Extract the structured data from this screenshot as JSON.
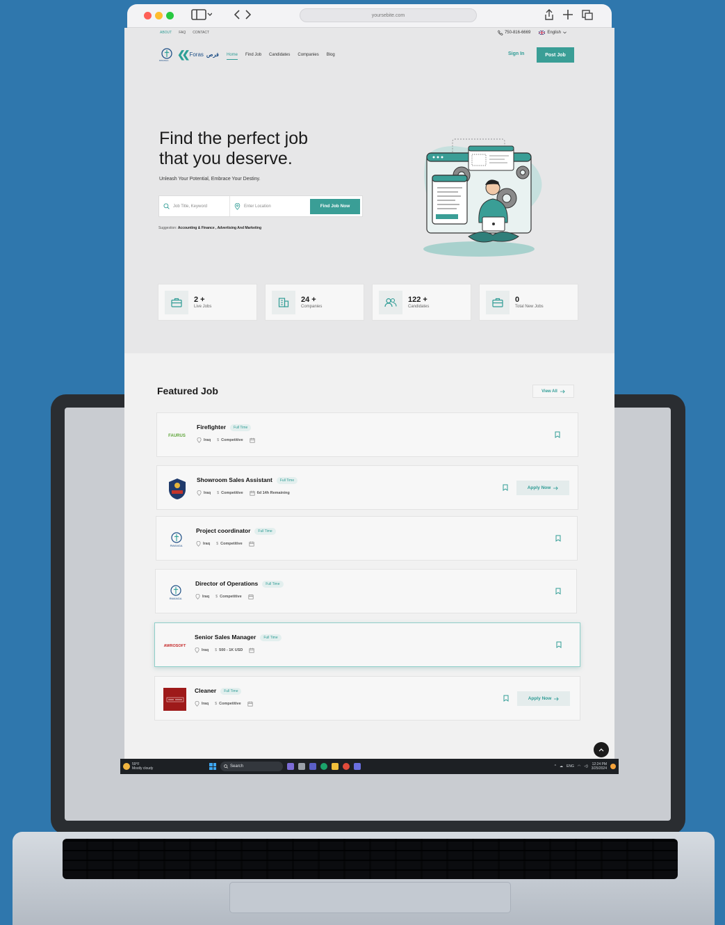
{
  "browser": {
    "url": "yoursebite.com",
    "colors": {
      "close": "#fe5f57",
      "minimize": "#febc2e",
      "maximize": "#28c840"
    }
  },
  "topbar": {
    "links": [
      "ABOUT",
      "FAQ",
      "CONTACT"
    ],
    "phone": "750-816-6669",
    "language": "English"
  },
  "header": {
    "logo_partner": "RWANGA",
    "logo_brand": "Foras",
    "logo_brand_ar": "فرص",
    "nav": [
      "Home",
      "Find Job",
      "Candidates",
      "Companies",
      "Blog"
    ],
    "sign_in": "Sign In",
    "post_job": "Post Job"
  },
  "hero": {
    "title_line1": "Find the perfect job",
    "title_line2": "that you deserve.",
    "subtitle": "Unleash Your Potential, Embrace Your Destiny.",
    "keyword_placeholder": "Job Title, Keyword",
    "location_placeholder": "Enter Location",
    "find_button": "Find Job Now",
    "suggestion_label": "Suggestion:",
    "suggestion_items": "Accounting & Finance , Advertising And Marketing"
  },
  "stats": [
    {
      "value": "2 +",
      "label": "Live Jobs",
      "icon": "briefcase-icon"
    },
    {
      "value": "24 +",
      "label": "Companies",
      "icon": "building-icon"
    },
    {
      "value": "122 +",
      "label": "Candidates",
      "icon": "users-icon"
    },
    {
      "value": "0",
      "label": "Total New Jobs",
      "icon": "briefcase-icon"
    }
  ],
  "featured": {
    "title": "Featured Job",
    "view_all": "View All",
    "jobs": [
      {
        "title": "Firefighter",
        "type": "Full Time",
        "location": "Iraq",
        "salary": "Competitive",
        "remaining": "",
        "company": "FAURUS",
        "apply": ""
      },
      {
        "title": "Showroom Sales Assistant",
        "type": "Full Time",
        "location": "Iraq",
        "salary": "Competitive",
        "remaining": "6d 14h Remaining",
        "company": "",
        "apply": "Apply Now"
      },
      {
        "title": "Project coordinator",
        "type": "Full Time",
        "location": "Iraq",
        "salary": "Competitive",
        "remaining": "",
        "company": "RWANGA",
        "apply": ""
      },
      {
        "title": "Director of Operations",
        "type": "Full Time",
        "location": "Iraq",
        "salary": "Competitive",
        "remaining": "",
        "company": "RWANGA",
        "apply": ""
      },
      {
        "title": "Senior Sales Manager",
        "type": "Full Time",
        "location": "Iraq",
        "salary": "500 - 1K USD",
        "remaining": "",
        "company": "AWROSOFT",
        "apply": ""
      },
      {
        "title": "Cleaner",
        "type": "Full Time",
        "location": "Iraq",
        "salary": "Competitive",
        "remaining": "",
        "company": "",
        "apply": "Apply Now"
      }
    ]
  },
  "taskbar": {
    "temperature": "59°F",
    "weather": "Mostly cloudy",
    "search": "Search",
    "lang": "ENG",
    "time": "12:24 PM",
    "date": "3/25/2024"
  },
  "theme": {
    "accent": "#3a9e96",
    "background": "#2f77ad"
  }
}
